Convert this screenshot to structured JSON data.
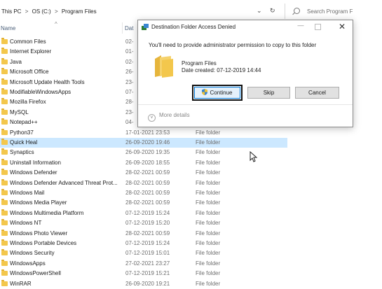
{
  "breadcrumb": [
    "This PC",
    "OS (C:)",
    "Program Files"
  ],
  "breadcrumb_sep": ">",
  "address_controls": {
    "dropdown": "⌄",
    "refresh": "↻"
  },
  "search": {
    "placeholder": "Search Program F"
  },
  "columns": {
    "name": "Name",
    "date": "Dat"
  },
  "files": [
    {
      "name": "Common Files",
      "date": "02-",
      "type": ""
    },
    {
      "name": "Internet Explorer",
      "date": "01-",
      "type": ""
    },
    {
      "name": "Java",
      "date": "02-",
      "type": ""
    },
    {
      "name": "Microsoft Office",
      "date": "26-",
      "type": ""
    },
    {
      "name": "Microsoft Update Health Tools",
      "date": "23-",
      "type": ""
    },
    {
      "name": "ModifiableWindowsApps",
      "date": "07-",
      "type": ""
    },
    {
      "name": "Mozilla Firefox",
      "date": "28-",
      "type": ""
    },
    {
      "name": "MySQL",
      "date": "23-",
      "type": ""
    },
    {
      "name": "Notepad++",
      "date": "04-",
      "type": ""
    },
    {
      "name": "Python37",
      "date": "17-01-2021 23:53",
      "type": "File folder"
    },
    {
      "name": "Quick Heal",
      "date": "26-09-2020 19:46",
      "type": "File folder",
      "selected": true
    },
    {
      "name": "Synaptics",
      "date": "26-09-2020 19:35",
      "type": "File folder"
    },
    {
      "name": "Uninstall Information",
      "date": "26-09-2020 18:55",
      "type": "File folder"
    },
    {
      "name": "Windows Defender",
      "date": "28-02-2021 00:59",
      "type": "File folder"
    },
    {
      "name": "Windows Defender Advanced Threat Prot...",
      "date": "28-02-2021 00:59",
      "type": "File folder"
    },
    {
      "name": "Windows Mail",
      "date": "28-02-2021 00:59",
      "type": "File folder"
    },
    {
      "name": "Windows Media Player",
      "date": "28-02-2021 00:59",
      "type": "File folder"
    },
    {
      "name": "Windows Multimedia Platform",
      "date": "07-12-2019 15:24",
      "type": "File folder"
    },
    {
      "name": "Windows NT",
      "date": "07-12-2019 15:20",
      "type": "File folder"
    },
    {
      "name": "Windows Photo Viewer",
      "date": "28-02-2021 00:59",
      "type": "File folder"
    },
    {
      "name": "Windows Portable Devices",
      "date": "07-12-2019 15:24",
      "type": "File folder"
    },
    {
      "name": "Windows Security",
      "date": "07-12-2019 15:01",
      "type": "File folder"
    },
    {
      "name": "WindowsApps",
      "date": "27-02-2021 23:27",
      "type": "File folder"
    },
    {
      "name": "WindowsPowerShell",
      "date": "07-12-2019 15:21",
      "type": "File folder"
    },
    {
      "name": "WinRAR",
      "date": "26-09-2020 19:21",
      "type": "File folder"
    }
  ],
  "dialog": {
    "title": "Destination Folder Access Denied",
    "message": "You'll need to provide administrator permission to copy to this folder",
    "folder_name": "Program Files",
    "folder_date": "Date created: 07-12-2019 14:44",
    "buttons": {
      "continue": "Continue",
      "skip": "Skip",
      "cancel": "Cancel"
    },
    "more_details": "More details",
    "controls": {
      "minimize": "—",
      "close": "✕"
    }
  },
  "colors": {
    "selection": "#cce8ff",
    "folder": "#f3c74c",
    "accent": "#0078d7"
  }
}
